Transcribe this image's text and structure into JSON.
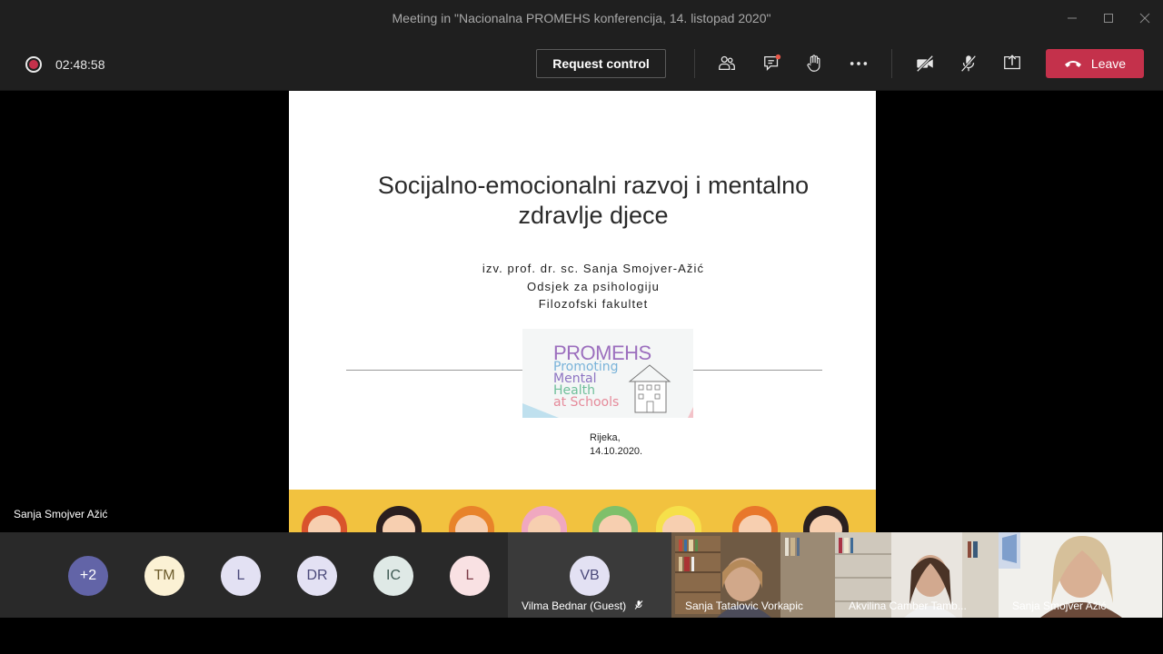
{
  "window": {
    "title": "Meeting in \"Nacionalna PROMEHS konferencija, 14. listopad 2020\""
  },
  "toolbar": {
    "timer": "02:48:58",
    "request_control_label": "Request control",
    "leave_label": "Leave"
  },
  "slide": {
    "title_line1": "Socijalno-emocionalni razvoj i mentalno",
    "title_line2": "zdravlje djece",
    "author_line1": "izv. prof. dr. sc. Sanja Smojver-Ažić",
    "author_line2": "Odsjek za psihologiju",
    "author_line3": "Filozofski fakultet",
    "logo_title": "PROMEHS",
    "logo_line1": "Promoting",
    "logo_line2": "Mental",
    "logo_line3": "Health",
    "logo_line4": "at Schools",
    "place": "Rijeka,",
    "date": "14.10.2020."
  },
  "stage": {
    "speaker_name": "Sanja Smojver Ažić"
  },
  "participants": {
    "avatars": [
      {
        "initials": "+2",
        "bg": "#6264a7",
        "fg": "#ffffff"
      },
      {
        "initials": "TM",
        "bg": "#fbf1d4",
        "fg": "#6b5a2a"
      },
      {
        "initials": "L",
        "bg": "#e3e1f3",
        "fg": "#4b4a7a"
      },
      {
        "initials": "DR",
        "bg": "#e3e1f3",
        "fg": "#4b4a7a"
      },
      {
        "initials": "IC",
        "bg": "#dfe9e6",
        "fg": "#3f5a53"
      },
      {
        "initials": "L",
        "bg": "#f9e1e3",
        "fg": "#7a3a45"
      }
    ],
    "vb": {
      "initials": "VB",
      "name": "Vilma Bednar (Guest)"
    },
    "videos": [
      {
        "name": "Sanja Tatalovic Vorkapic"
      },
      {
        "name": "Akvilina Camber Tamb..."
      },
      {
        "name": "Sanja Smojver Ažić"
      }
    ]
  },
  "colors": {
    "leave": "#c4314b",
    "teams_purple": "#6264a7",
    "toolbar_bg": "#1f1f1f"
  }
}
